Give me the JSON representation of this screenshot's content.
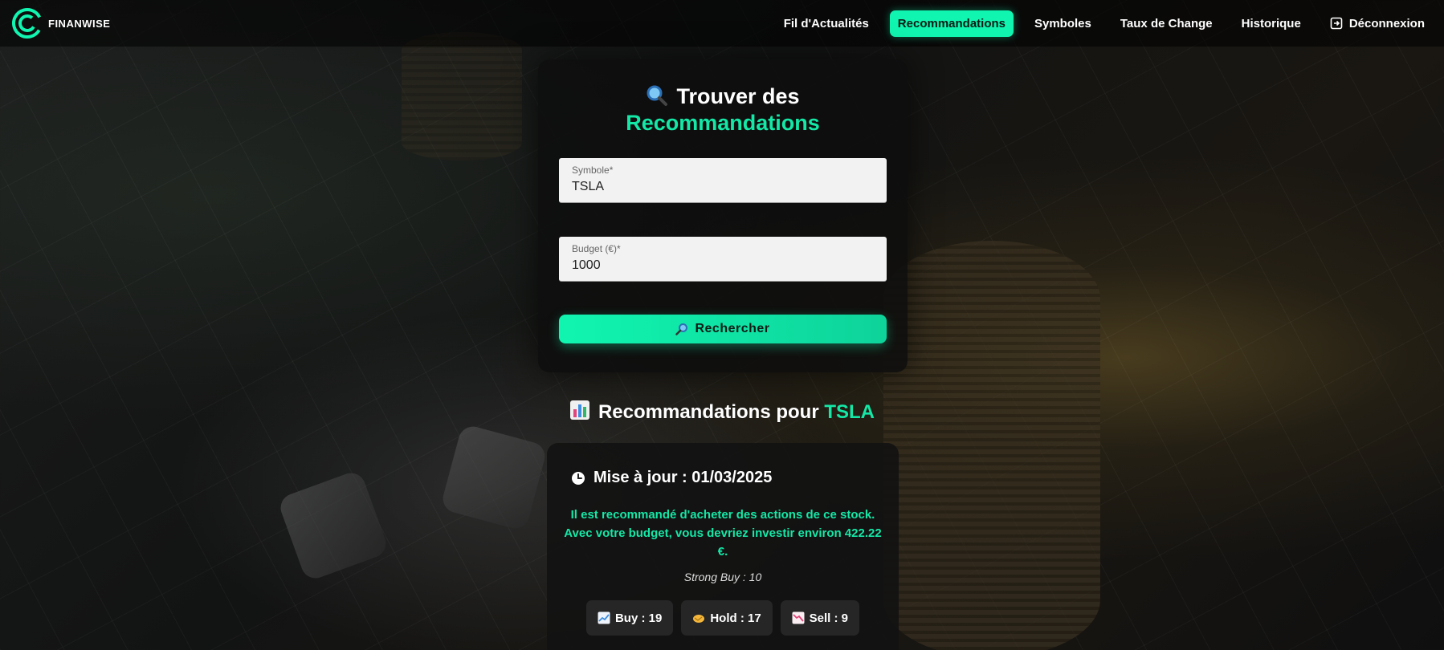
{
  "brand": {
    "name": "FINANWISE",
    "logo_icon": "finanwise-logo-icon",
    "accent": "#10f5b0"
  },
  "nav": {
    "items": [
      {
        "label": "Fil d'Actualités",
        "active": false
      },
      {
        "label": "Recommandations",
        "active": true
      },
      {
        "label": "Symboles",
        "active": false
      },
      {
        "label": "Taux de Change",
        "active": false
      },
      {
        "label": "Historique",
        "active": false
      }
    ],
    "logout": {
      "label": "Déconnexion",
      "icon": "logout-icon"
    }
  },
  "search": {
    "title_line1": "Trouver des",
    "title_line2": "Recommandations",
    "title_icon": "magnifier-icon",
    "symbol": {
      "label": "Symbole*",
      "value": "TSLA"
    },
    "budget": {
      "label": "Budget (€)*",
      "value": "1000"
    },
    "button_label": "Rechercher",
    "button_icon": "magnifier-icon"
  },
  "results": {
    "title_prefix": "Recommandations pour",
    "symbol": "TSLA",
    "title_icon": "bar-chart-icon",
    "updated": "Mise à jour : 01/03/2025",
    "updated_icon": "clock-icon",
    "recommendation": "Il est recommandé d'acheter des actions de ce stock. Avec votre budget, vous devriez investir environ 422.22 €.",
    "strong_buy": "Strong Buy : 10",
    "badges": [
      {
        "label": "Buy : 19",
        "icon": "chart-up-icon"
      },
      {
        "label": "Hold : 17",
        "icon": "handshake-icon"
      },
      {
        "label": "Sell : 9",
        "icon": "chart-down-icon"
      }
    ]
  }
}
